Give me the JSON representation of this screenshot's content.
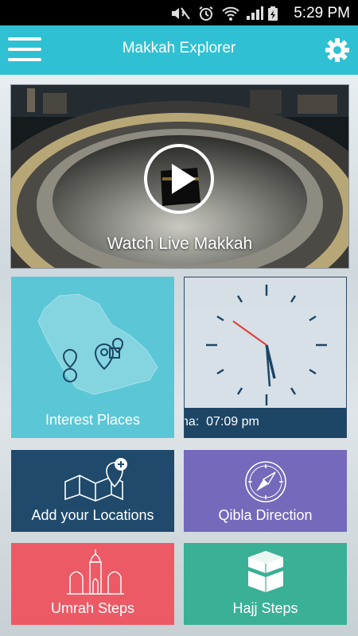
{
  "status_bar": {
    "time": "5:29 PM",
    "icons": [
      "mute-icon",
      "alarm-icon",
      "wifi-icon",
      "signal-icon",
      "battery-charging-icon"
    ]
  },
  "app_bar": {
    "title": "Makkah Explorer",
    "menu_icon": "hamburger-menu-icon",
    "settings_icon": "gear-icon",
    "color": "#2fc1d3"
  },
  "video": {
    "caption": "Watch Live Makkah",
    "icon": "play-icon"
  },
  "tiles": {
    "interest": {
      "label": "Interest Places",
      "icon": "saudi-map-pins-icon",
      "color": "#5bc7d6"
    },
    "clock": {
      "prefix": "na:",
      "time": "07:09 pm",
      "bar_color": "#1d4666"
    },
    "add_locations": {
      "label": "Add your Locations",
      "icon": "map-add-pin-icon",
      "color": "#1f4a6b"
    },
    "qibla": {
      "label": "Qibla Direction",
      "icon": "compass-icon",
      "color": "#7469bb"
    },
    "umrah": {
      "label": "Umrah Steps",
      "icon": "mosque-icon",
      "color": "#ec5a66"
    },
    "hajj": {
      "label": "Hajj Steps",
      "icon": "kaaba-icon",
      "color": "#3ab096"
    }
  }
}
